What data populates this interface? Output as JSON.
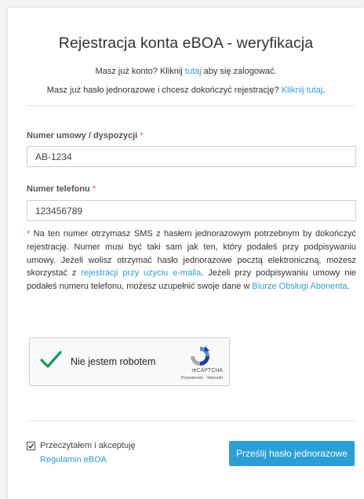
{
  "header": {
    "title": "Rejestracja konta eBOA - weryfikacja",
    "login_prompt_before": "Masz już konto? Kliknij ",
    "login_link": "tutaj",
    "login_prompt_after": " aby się zalogować.",
    "otp_prompt": "Masz już hasło jednorazowe i chcesz dokończyć rejestrację? ",
    "otp_link": "Kliknij tutaj",
    "otp_after": "."
  },
  "form": {
    "contract": {
      "label": "Numer umowy / dyspozycji",
      "required_mark": "*",
      "value": "AB-1234"
    },
    "phone": {
      "label": "Numer telefonu",
      "required_mark": "*",
      "value": "123456789"
    }
  },
  "note": {
    "star": "*",
    "text1": " Na ten numer otrzymasz SMS z hasłem jednorazowym potrzebnym by dokończyć rejestrację. Numer musi być taki sam jak ten, który podałeś przy podpisywaniu umowy. Jeżeli wolisz otrzymać hasło jednorazowe pocztą elektroniczną, możesz skorzystać z ",
    "link1": "rejestracji przy użyciu e-maila",
    "text2": ". Jeżeli przy podpisywaniu umowy nie podałeś numeru telefonu, możesz uzupełnić swoje dane w ",
    "link2": "Biurze Obsługi Abonenta",
    "text3": "."
  },
  "captcha": {
    "label": "Nie jestem robotem",
    "brand": "reCAPTCHA",
    "terms": "Prywatność - Warunki",
    "checked": true,
    "check_color": "#0f9d58"
  },
  "footer": {
    "agree_text": "Przeczytałem i akceptuję",
    "agree_link": "Regulamin eBOA",
    "checkbox_checked": true,
    "submit_label": "Prześlij hasło jednorazowe"
  },
  "colors": {
    "accent": "#2a9fd6",
    "required": "#e74c3c"
  }
}
